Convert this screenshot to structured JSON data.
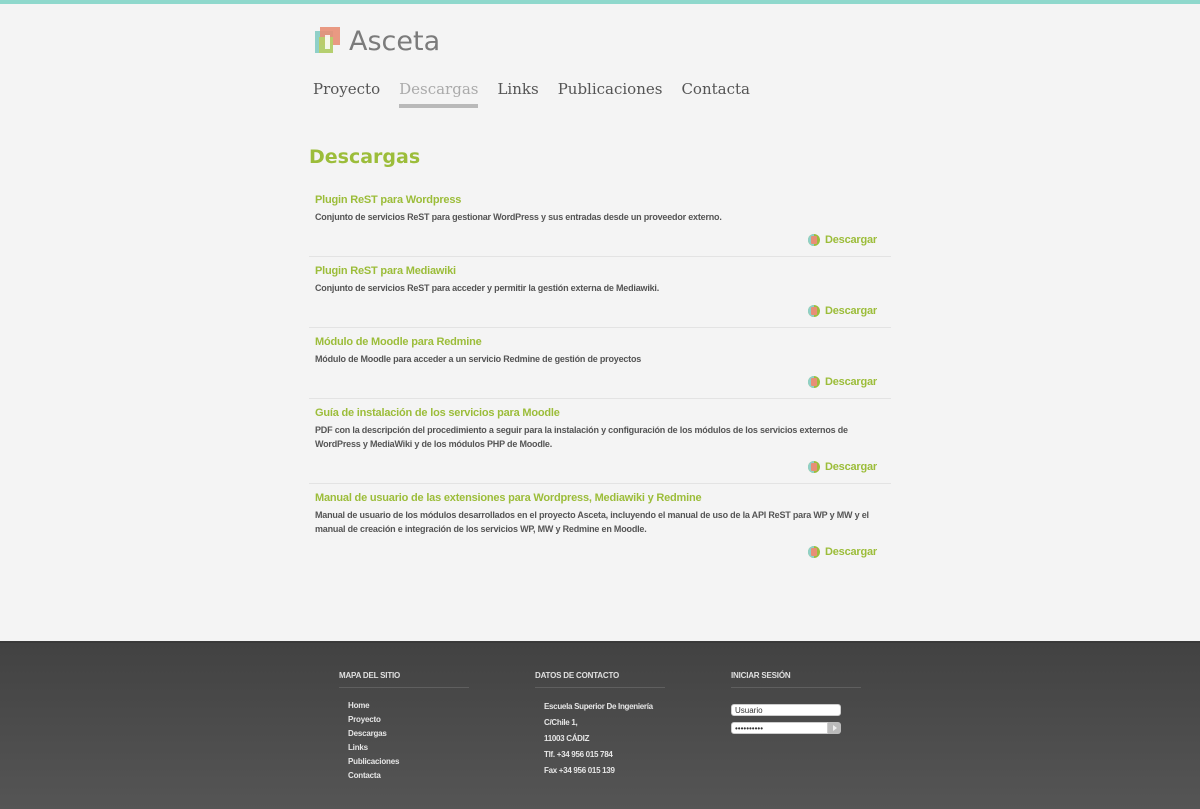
{
  "brand": {
    "name": "Asceta"
  },
  "nav": [
    {
      "label": "Proyecto",
      "active": false
    },
    {
      "label": "Descargas",
      "active": true
    },
    {
      "label": "Links",
      "active": false
    },
    {
      "label": "Publicaciones",
      "active": false
    },
    {
      "label": "Contacta",
      "active": false
    }
  ],
  "page": {
    "title": "Descargas"
  },
  "downloads": [
    {
      "title": "Plugin ReST para Wordpress",
      "description": "Conjunto de servicios ReST para gestionar WordPress y sus entradas desde un proveedor externo.",
      "link": "Descargar"
    },
    {
      "title": "Plugin ReST para Mediawiki",
      "description": "Conjunto de servicios ReST para acceder y permitir la gestión externa de Mediawiki.",
      "link": "Descargar"
    },
    {
      "title": "Módulo de Moodle para Redmine",
      "description": "Módulo de Moodle para acceder a un servicio Redmine de gestión de proyectos",
      "link": "Descargar"
    },
    {
      "title": "Guía de instalación de los servicios para Moodle",
      "description": "PDF con la descripción del procedimiento a seguir para la instalación y configuración de los módulos de los servicios externos de WordPress y MediaWiki y de los módulos PHP de Moodle.",
      "link": "Descargar"
    },
    {
      "title": "Manual de usuario de las extensiones para Wordpress, Mediawiki y Redmine",
      "description": "Manual de usuario de los módulos desarrollados en el proyecto Asceta, incluyendo el manual de uso de la API ReST para WP y MW y el manual de creación e integración de los servicios WP, MW y Redmine en Moodle.",
      "link": "Descargar"
    }
  ],
  "footer": {
    "sitemap": {
      "heading": "Mapa del sitio",
      "links": [
        "Home",
        "Proyecto",
        "Descargas",
        "Links",
        "Publicaciones",
        "Contacta"
      ]
    },
    "contact": {
      "heading": "Datos de contacto",
      "lines": [
        "Escuela Superior De Ingeniería",
        "C/Chile 1,",
        "11003 CÁDIZ",
        "Tlf. +34 956 015 784",
        "Fax +34 956 015 139"
      ]
    },
    "login": {
      "heading": "Iniciar sesión",
      "username_value": "Usuario",
      "password_value": "••••••••••"
    }
  },
  "colors": {
    "accent": "#9cbd3a",
    "topbar": "#8fd8cc",
    "footer": "#4a4a4a"
  }
}
